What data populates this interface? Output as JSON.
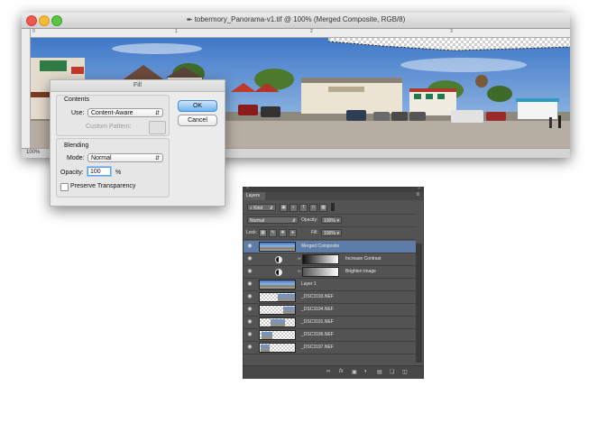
{
  "document": {
    "title": "tobermory_Panorama-v1.tif @ 100% (Merged Composite, RGB/8)",
    "zoom": "100%",
    "ruler_marks": [
      "0",
      "1",
      "2",
      "3",
      "4"
    ]
  },
  "fill_dialog": {
    "title": "Fill",
    "contents_label": "Contents",
    "use_label": "Use:",
    "use_value": "Content-Aware",
    "custom_pattern_label": "Custom Pattern:",
    "blending_label": "Blending",
    "mode_label": "Mode:",
    "mode_value": "Normal",
    "opacity_label": "Opacity:",
    "opacity_value": "100",
    "opacity_unit": "%",
    "preserve_label": "Preserve Transparency",
    "preserve_checked": false,
    "ok_label": "OK",
    "cancel_label": "Cancel"
  },
  "layers_panel": {
    "tab_label": "Layers",
    "filter_kind": "Kind",
    "blend_mode": "Normal",
    "opacity_label": "Opacity:",
    "opacity_value": "100%",
    "lock_label": "Lock:",
    "fill_label": "Fill:",
    "fill_value": "100%",
    "layers": [
      {
        "name": "Merged Composite",
        "type": "pixel",
        "selected": true
      },
      {
        "name": "Increase Contrast",
        "type": "adjustment",
        "selected": false
      },
      {
        "name": "Brighten Image",
        "type": "adjustment",
        "selected": false
      },
      {
        "name": "Layer 1",
        "type": "pixel",
        "selected": false
      },
      {
        "name": "_DSC3193.NEF",
        "type": "pixel",
        "selected": false
      },
      {
        "name": "_DSC3194.NEF",
        "type": "pixel",
        "selected": false
      },
      {
        "name": "_DSC3191.NEF",
        "type": "pixel",
        "selected": false
      },
      {
        "name": "_DSC3196.NEF",
        "type": "pixel",
        "selected": false
      },
      {
        "name": "_DSC3197.NEF",
        "type": "pixel",
        "selected": false
      }
    ],
    "bottom_icons": [
      "link-icon",
      "fx-icon",
      "mask-icon",
      "adjustment-icon",
      "folder-icon",
      "new-layer-icon",
      "trash-icon"
    ]
  },
  "colors": {
    "panel_bg": "#535353",
    "selected_layer": "#5d7da8",
    "ok_button": "#6fb4f3"
  }
}
